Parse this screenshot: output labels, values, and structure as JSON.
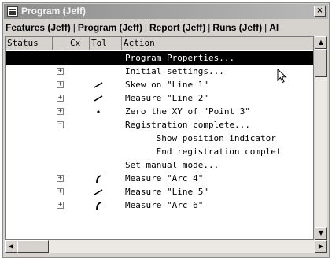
{
  "window": {
    "title": "Program (Jeff)",
    "close_label": "×"
  },
  "tabs": [
    {
      "label": "Features (Jeff)"
    },
    {
      "label": "Program (Jeff)"
    },
    {
      "label": "Report (Jeff)"
    },
    {
      "label": "Runs (Jeff)"
    },
    {
      "label": "Al"
    }
  ],
  "tab_separator": "|",
  "columns": [
    {
      "label": "Status"
    },
    {
      "label": ""
    },
    {
      "label": "Cx"
    },
    {
      "label": "Tol"
    },
    {
      "label": "Action"
    }
  ],
  "rows": [
    {
      "action": "Program Properties...",
      "expander": "",
      "tol_icon": "",
      "indent": 0,
      "selected": true
    },
    {
      "action": "Initial settings...",
      "expander": "+",
      "tol_icon": "",
      "indent": 0,
      "selected": false
    },
    {
      "action": "Skew on \"Line 1\"",
      "expander": "+",
      "tol_icon": "line-icon",
      "indent": 0,
      "selected": false
    },
    {
      "action": "Measure \"Line 2\"",
      "expander": "+",
      "tol_icon": "line-icon",
      "indent": 0,
      "selected": false
    },
    {
      "action": "Zero the XY of \"Point 3\"",
      "expander": "+",
      "tol_icon": "point-icon",
      "indent": 0,
      "selected": false
    },
    {
      "action": "Registration complete...",
      "expander": "−",
      "tol_icon": "",
      "indent": 0,
      "selected": false
    },
    {
      "action": "Show position indicator",
      "expander": "",
      "tol_icon": "",
      "indent": 2,
      "selected": false
    },
    {
      "action": "End registration complet",
      "expander": "",
      "tol_icon": "",
      "indent": 2,
      "selected": false
    },
    {
      "action": "Set manual mode...",
      "expander": "",
      "tol_icon": "",
      "indent": 0,
      "selected": false
    },
    {
      "action": "Measure \"Arc 4\"",
      "expander": "+",
      "tol_icon": "arc-icon",
      "indent": 0,
      "selected": false
    },
    {
      "action": "Measure \"Line 5\"",
      "expander": "+",
      "tol_icon": "line-icon",
      "indent": 0,
      "selected": false
    },
    {
      "action": "Measure \"Arc 6\"",
      "expander": "+",
      "tol_icon": "arc-icon",
      "indent": 0,
      "selected": false
    }
  ],
  "scrollbars": {
    "up": "▲",
    "down": "▼",
    "left": "◀",
    "right": "▶"
  }
}
